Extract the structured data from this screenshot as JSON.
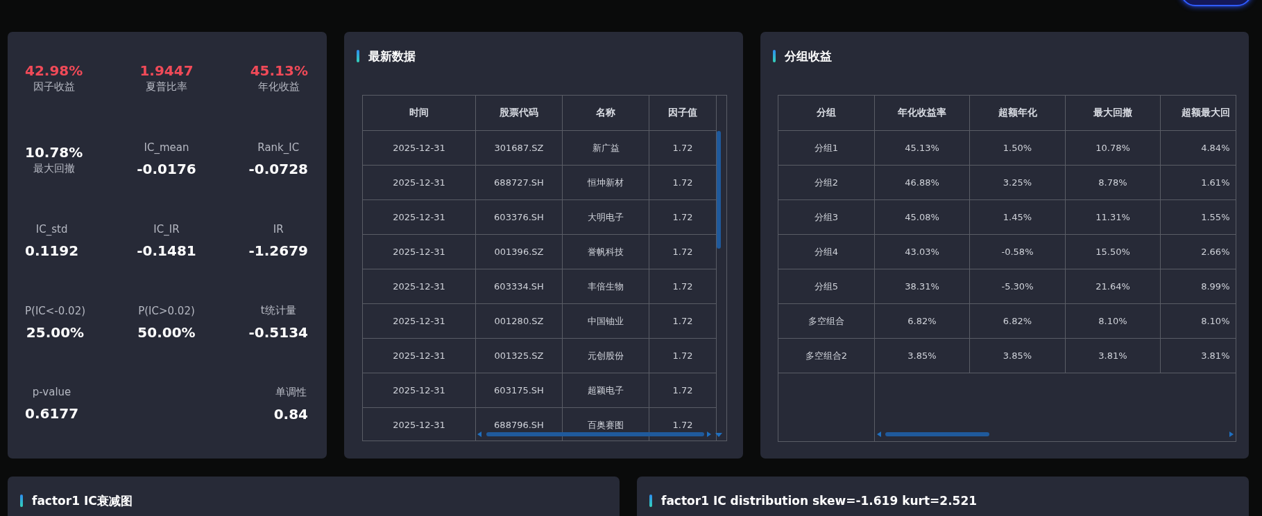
{
  "stat_rows": [
    [
      {
        "label": "因子收益",
        "value": "42.98%",
        "kind": "value_first",
        "color": "#f04a58"
      },
      {
        "label": "夏普比率",
        "value": "1.9447",
        "kind": "value_first",
        "color": "#f04a58"
      },
      {
        "label": "年化收益",
        "value": "45.13%",
        "kind": "value_first",
        "color": "#f04a58"
      }
    ],
    [
      {
        "label": "最大回撤",
        "value": "10.78%",
        "kind": "value_first",
        "color": "#ffffff"
      },
      {
        "label": "IC_mean",
        "value": "-0.0176",
        "kind": "label_first",
        "color": "#ffffff"
      },
      {
        "label": "Rank_IC",
        "value": "-0.0728",
        "kind": "label_first",
        "color": "#ffffff"
      }
    ],
    [
      {
        "label": "IC_std",
        "value": "0.1192",
        "kind": "label_first",
        "color": "#ffffff"
      },
      {
        "label": "IC_IR",
        "value": "-0.1481",
        "kind": "label_first",
        "color": "#ffffff"
      },
      {
        "label": "IR",
        "value": "-1.2679",
        "kind": "label_first",
        "color": "#ffffff"
      }
    ],
    [
      {
        "label": "P(IC<-0.02)",
        "value": "25.00%",
        "kind": "label_first",
        "color": "#ffffff"
      },
      {
        "label": "P(IC>0.02)",
        "value": "50.00%",
        "kind": "label_first",
        "color": "#ffffff"
      },
      {
        "label": "t统计量",
        "value": "-0.5134",
        "kind": "label_first",
        "color": "#ffffff"
      }
    ],
    [
      {
        "label": "p-value",
        "value": "0.6177",
        "kind": "label_first",
        "color": "#ffffff"
      },
      {
        "label": "单调性",
        "value": "0.84",
        "kind": "label_first",
        "color": "#ffffff"
      }
    ]
  ],
  "latest_data": {
    "title": "最新数据",
    "columns": [
      "时间",
      "股票代码",
      "名称",
      "因子值"
    ],
    "rows": [
      [
        "2025-12-31",
        "301687.SZ",
        "新广益",
        "1.72"
      ],
      [
        "2025-12-31",
        "688727.SH",
        "恒坤新材",
        "1.72"
      ],
      [
        "2025-12-31",
        "603376.SH",
        "大明电子",
        "1.72"
      ],
      [
        "2025-12-31",
        "001396.SZ",
        "誉帆科技",
        "1.72"
      ],
      [
        "2025-12-31",
        "603334.SH",
        "丰倍生物",
        "1.72"
      ],
      [
        "2025-12-31",
        "001280.SZ",
        "中国铀业",
        "1.72"
      ],
      [
        "2025-12-31",
        "001325.SZ",
        "元创股份",
        "1.72"
      ],
      [
        "2025-12-31",
        "603175.SH",
        "超颖电子",
        "1.72"
      ],
      [
        "2025-12-31",
        "688796.SH",
        "百奥赛图",
        "1.72"
      ]
    ]
  },
  "group_returns": {
    "title": "分组收益",
    "columns": [
      "分组",
      "年化收益率",
      "超额年化",
      "最大回撤",
      "超额最大回"
    ],
    "rows": [
      [
        "分组1",
        "45.13%",
        "1.50%",
        "10.78%",
        "4.84%"
      ],
      [
        "分组2",
        "46.88%",
        "3.25%",
        "8.78%",
        "1.61%"
      ],
      [
        "分组3",
        "45.08%",
        "1.45%",
        "11.31%",
        "1.55%"
      ],
      [
        "分组4",
        "43.03%",
        "-0.58%",
        "15.50%",
        "2.66%"
      ],
      [
        "分组5",
        "38.31%",
        "-5.30%",
        "21.64%",
        "8.99%"
      ],
      [
        "多空组合",
        "6.82%",
        "6.82%",
        "8.10%",
        "8.10%"
      ],
      [
        "多空组合2",
        "3.85%",
        "3.85%",
        "3.81%",
        "3.81%"
      ]
    ]
  },
  "decay_panel": {
    "title": "factor1 IC衰减图"
  },
  "distribution_panel": {
    "title": "factor1 IC distribution skew=-1.619 kurt=2.521"
  }
}
